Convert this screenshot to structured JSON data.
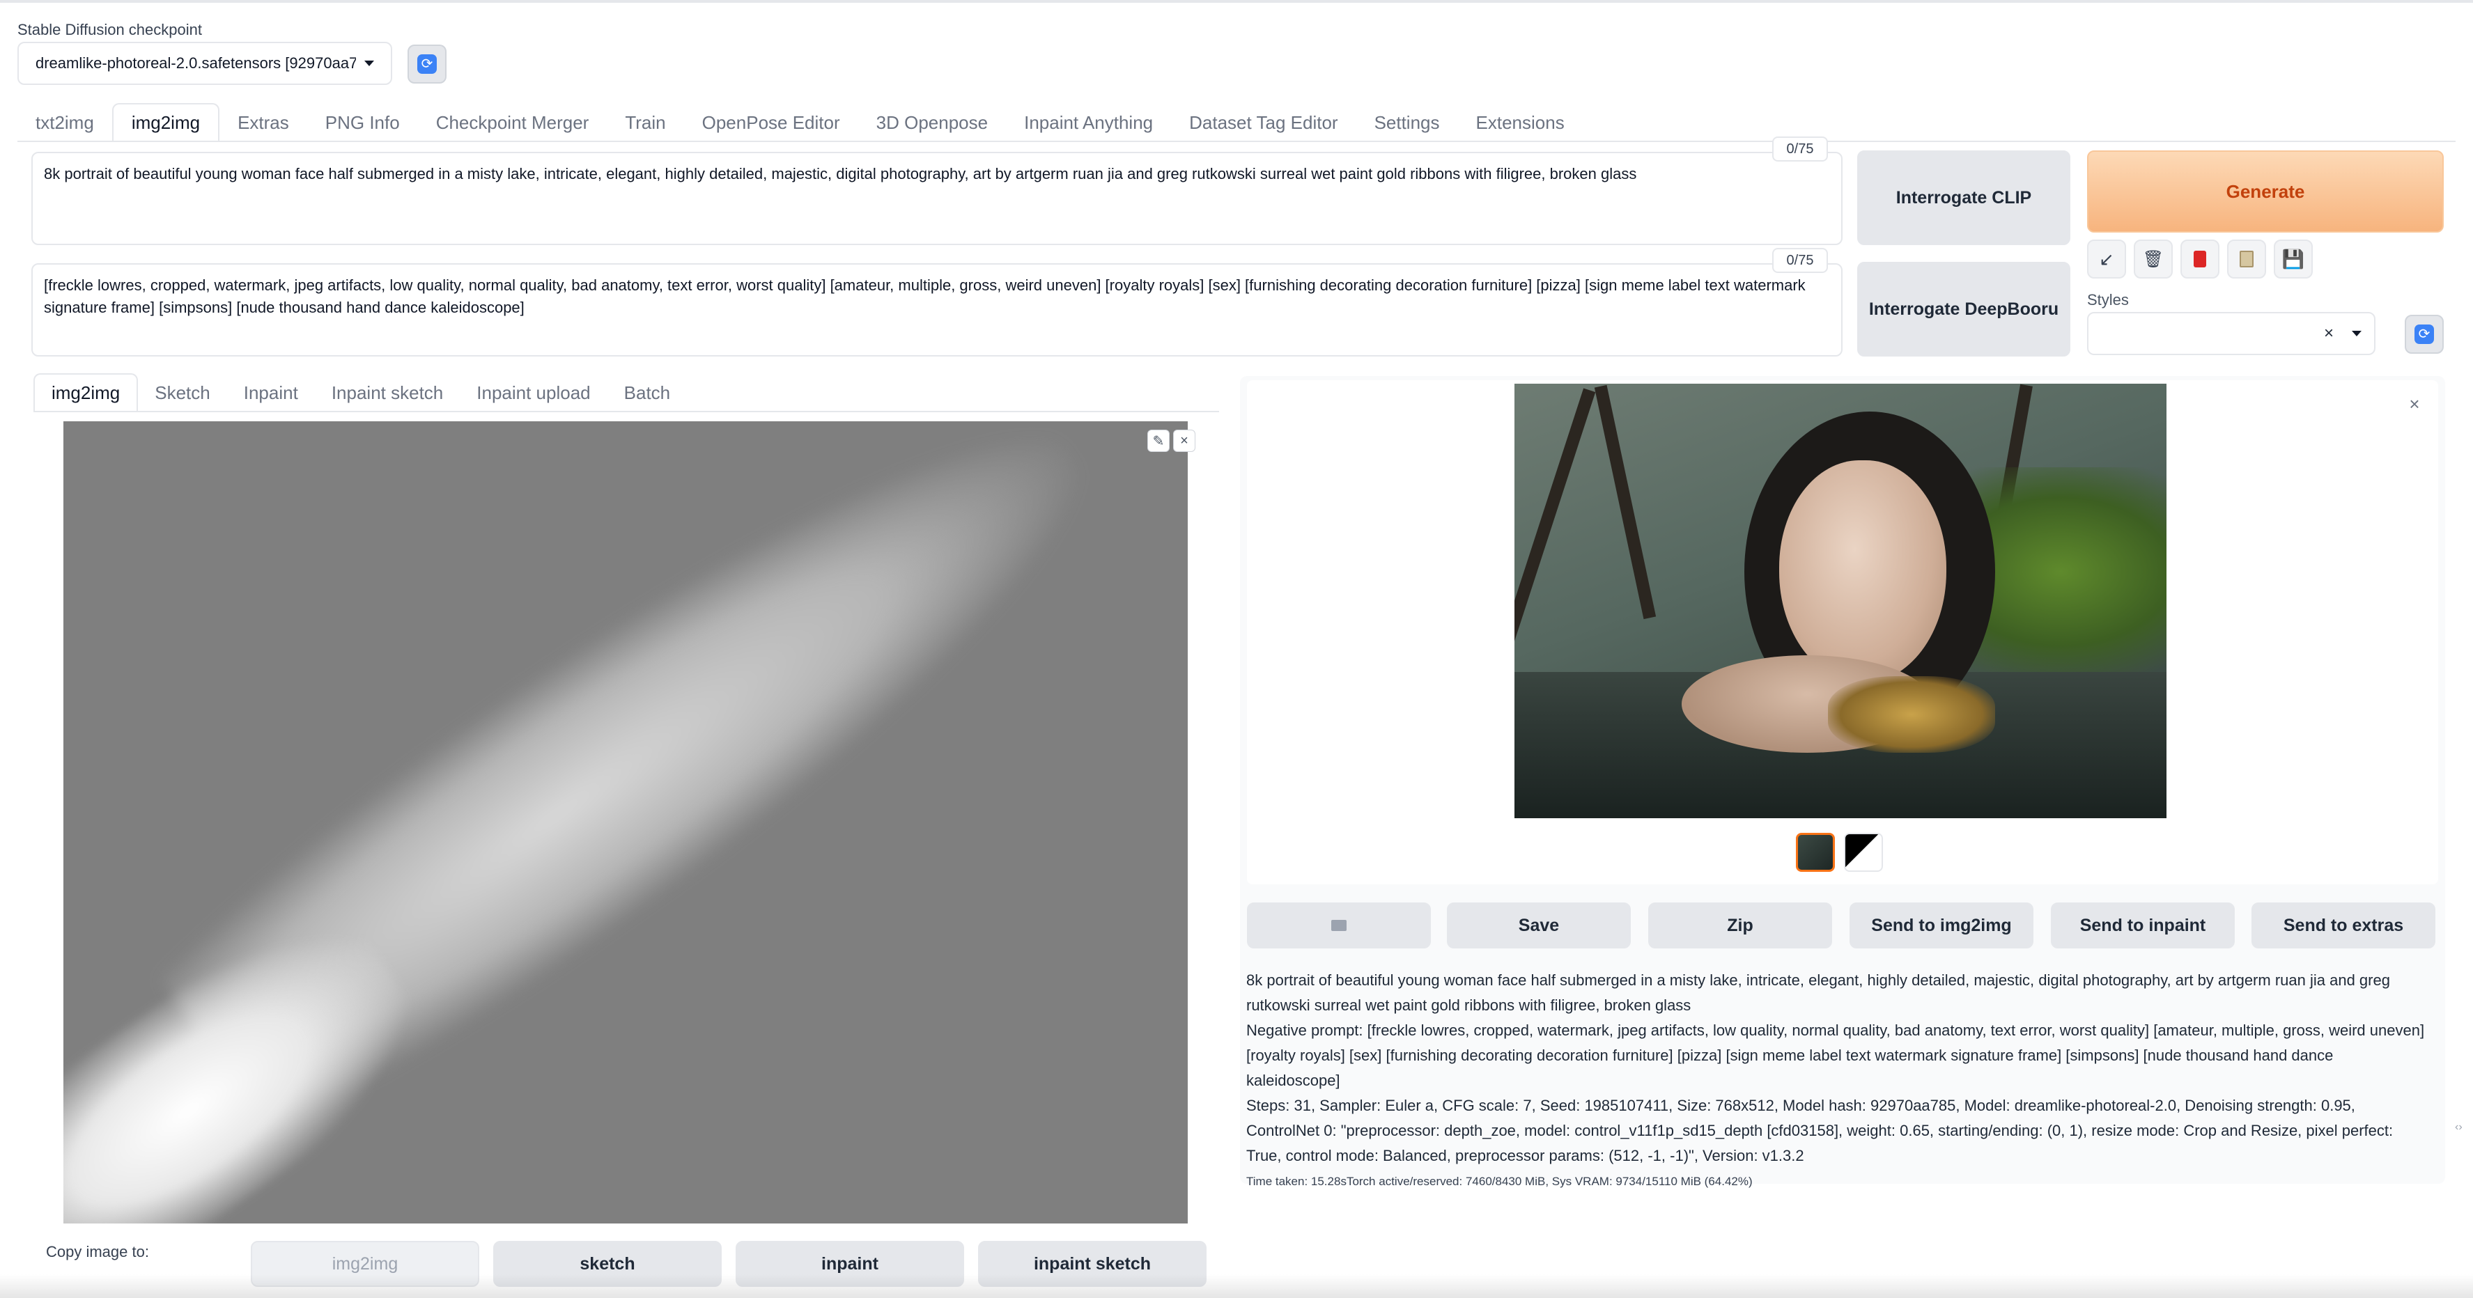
{
  "checkpoint": {
    "label": "Stable Diffusion checkpoint",
    "value": "dreamlike-photoreal-2.0.safetensors [92970aa7"
  },
  "main_tabs": [
    "txt2img",
    "img2img",
    "Extras",
    "PNG Info",
    "Checkpoint Merger",
    "Train",
    "OpenPose Editor",
    "3D Openpose",
    "Inpaint Anything",
    "Dataset Tag Editor",
    "Settings",
    "Extensions"
  ],
  "prompt": {
    "positive": "8k portrait of beautiful young woman face half submerged in a misty lake, intricate, elegant, highly detailed, majestic, digital photography, art by artgerm ruan jia and greg rutkowski surreal wet paint gold ribbons with filigree, broken glass",
    "positive_counter": "0/75",
    "negative": "[freckle lowres, cropped, watermark, jpeg artifacts, low quality, normal quality, bad anatomy, text error, worst quality] [amateur, multiple, gross, weird uneven] [royalty royals] [sex] [furnishing decorating decoration furniture] [pizza] [sign meme label text watermark signature frame] [simpsons] [nude thousand hand dance kaleidoscope]",
    "negative_counter": "0/75"
  },
  "interrogate": {
    "clip": "Interrogate CLIP",
    "deepbooru": "Interrogate DeepBooru"
  },
  "generate_label": "Generate",
  "tools": [
    "arrow-icon",
    "trash-icon",
    "red-card-icon",
    "clipboard-icon",
    "save-icon"
  ],
  "styles": {
    "label": "Styles",
    "clear": "×"
  },
  "sub_tabs": [
    "img2img",
    "Sketch",
    "Inpaint",
    "Inpaint sketch",
    "Inpaint upload",
    "Batch"
  ],
  "copy_image": {
    "label": "Copy image to:",
    "buttons": [
      "img2img",
      "sketch",
      "inpaint",
      "inpaint sketch"
    ]
  },
  "output_buttons": [
    "Save",
    "Zip",
    "Send to img2img",
    "Send to inpaint",
    "Send to extras"
  ],
  "info": {
    "prompt": "8k portrait of beautiful young woman face half submerged in a misty lake, intricate, elegant, highly detailed, majestic, digital photography, art by artgerm ruan jia and greg rutkowski surreal wet paint gold ribbons with filigree, broken glass",
    "negative": "Negative prompt: [freckle lowres, cropped, watermark, jpeg artifacts, low quality, normal quality, bad anatomy, text error, worst quality] [amateur, multiple, gross, weird uneven] [royalty royals] [sex] [furnishing decorating decoration furniture] [pizza] [sign meme label text watermark signature frame] [simpsons] [nude thousand hand dance kaleidoscope]",
    "params": "Steps: 31, Sampler: Euler a, CFG scale: 7, Seed: 1985107411, Size: 768x512, Model hash: 92970aa785, Model: dreamlike-photoreal-2.0, Denoising strength: 0.95, ControlNet 0: \"preprocessor: depth_zoe, model: control_v11f1p_sd15_depth [cfd03158], weight: 0.65, starting/ending: (0, 1), resize mode: Crop and Resize, pixel perfect: True, control mode: Balanced, preprocessor params: (512, -1, -1)\", Version: v1.3.2",
    "timing": "Time taken: 15.28sTorch active/reserved: 7460/8430 MiB, Sys VRAM: 9734/15110 MiB (64.42%)"
  },
  "colors": {
    "accent": "#f97316",
    "generate_bg": "#f9c79a",
    "generate_text": "#c2410c",
    "refresh_icon": "#3b82f6"
  }
}
